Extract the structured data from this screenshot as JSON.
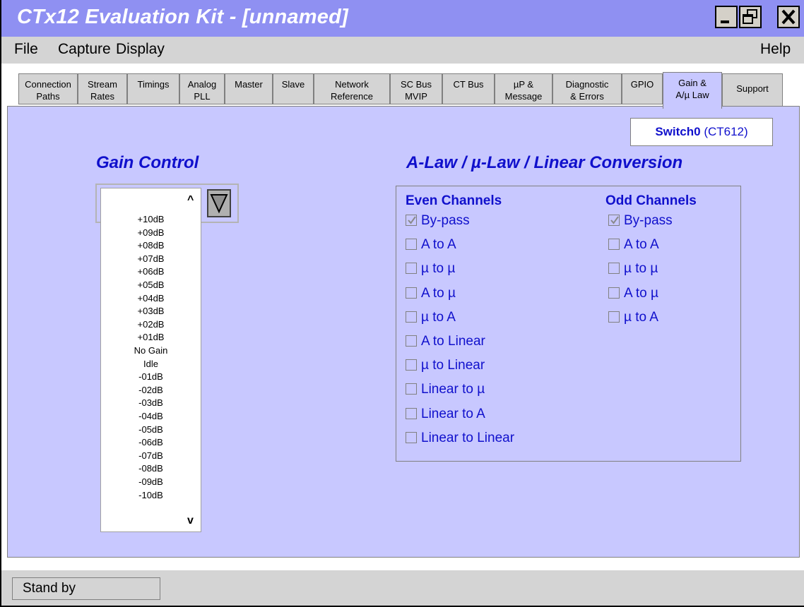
{
  "window": {
    "title": "CTx12 Evaluation Kit - [unnamed]"
  },
  "menu": {
    "file": "File",
    "capture": "Capture",
    "display": "Display",
    "help": "Help"
  },
  "tabs": [
    {
      "line1": "Connection",
      "line2": "Paths"
    },
    {
      "line1": "Stream",
      "line2": "Rates"
    },
    {
      "line1": "Timings",
      "line2": ""
    },
    {
      "line1": "Analog",
      "line2": "PLL"
    },
    {
      "line1": "Master",
      "line2": ""
    },
    {
      "line1": "Slave",
      "line2": ""
    },
    {
      "line1": "Network",
      "line2": "Reference"
    },
    {
      "line1": "SC Bus",
      "line2": "MVIP"
    },
    {
      "line1": "CT Bus",
      "line2": ""
    },
    {
      "line1": "µP &",
      "line2": "Message"
    },
    {
      "line1": "Diagnostic",
      "line2": "& Errors"
    },
    {
      "line1": "GPIO",
      "line2": ""
    },
    {
      "line1": "Gain &",
      "line2": "A/µ Law"
    },
    {
      "line1": "Support",
      "line2": ""
    }
  ],
  "active_tab": "Gain & A/µ Law",
  "switch_label": {
    "name": "Switch0",
    "model": "(CT612)"
  },
  "gain_control": {
    "heading": "Gain Control",
    "scroll_up": "^",
    "scroll_down": "v",
    "options": [
      "+10dB",
      "+09dB",
      "+08dB",
      "+07dB",
      "+06dB",
      "+05dB",
      "+04dB",
      "+03dB",
      "+02dB",
      "+01dB",
      "No Gain",
      "Idle",
      "-01dB",
      "-02dB",
      "-03dB",
      "-04dB",
      "-05dB",
      "-06dB",
      "-07dB",
      "-08dB",
      "-09dB",
      "-10dB"
    ]
  },
  "conversion": {
    "heading": "A-Law / µ-Law / Linear Conversion",
    "even": {
      "title": "Even Channels",
      "options": [
        {
          "label": "By-pass",
          "checked": true
        },
        {
          "label": "A to A",
          "checked": false
        },
        {
          "label": "µ to µ",
          "checked": false
        },
        {
          "label": "A to µ",
          "checked": false
        },
        {
          "label": "µ to A",
          "checked": false
        },
        {
          "label": "A to Linear",
          "checked": false
        },
        {
          "label": "µ to Linear",
          "checked": false
        },
        {
          "label": "Linear to µ",
          "checked": false
        },
        {
          "label": "Linear to A",
          "checked": false
        },
        {
          "label": "Linear to Linear",
          "checked": false
        }
      ]
    },
    "odd": {
      "title": "Odd Channels",
      "options": [
        {
          "label": "By-pass",
          "checked": true
        },
        {
          "label": "A to A",
          "checked": false
        },
        {
          "label": "µ to µ",
          "checked": false
        },
        {
          "label": "A to µ",
          "checked": false
        },
        {
          "label": "µ to A",
          "checked": false
        }
      ]
    }
  },
  "status": {
    "text": "Stand by"
  },
  "colors": {
    "titlebar": "#8f90f2",
    "panel": "#c8c8ff",
    "accent_text": "#1010cc",
    "chrome": "#d4d4d4"
  },
  "icons": {
    "minimize": "minimize-icon",
    "maximize": "maximize-icon",
    "close": "close-icon",
    "dropdown": "triangle-down-icon",
    "check": "checkmark-icon"
  }
}
